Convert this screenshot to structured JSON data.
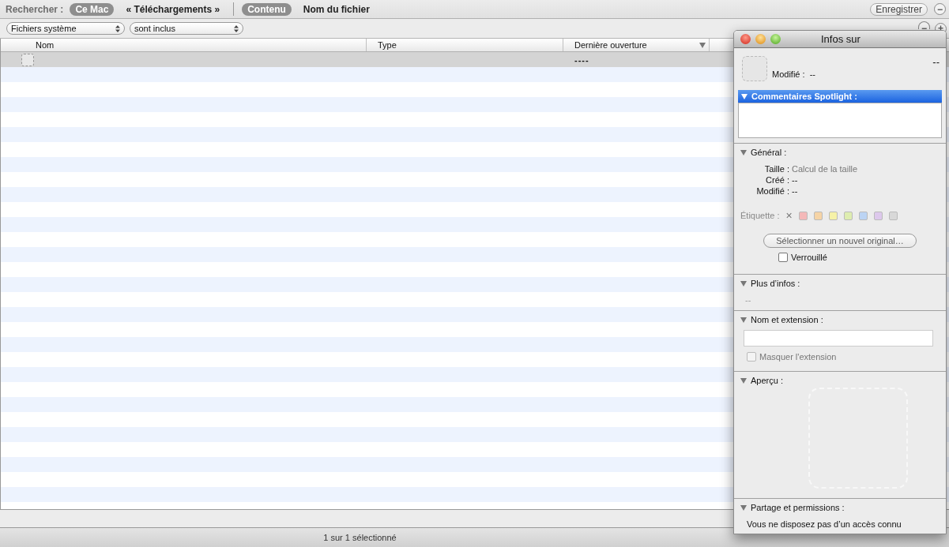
{
  "search_bar": {
    "label": "Rechercher :",
    "scopes": [
      {
        "label": "Ce Mac",
        "selected": true
      },
      {
        "label": "« Téléchargements »",
        "selected": false
      }
    ],
    "criteria": [
      {
        "label": "Contenu",
        "selected": true
      },
      {
        "label": "Nom du fichier",
        "selected": false
      }
    ],
    "save_button": "Enregistrer",
    "remove_symbol": "−"
  },
  "rule": {
    "attribute": "Fichiers système",
    "operator": "sont inclus",
    "remove_symbol": "−",
    "add_symbol": "+"
  },
  "table": {
    "columns": [
      {
        "label": "Nom",
        "sorted": false
      },
      {
        "label": "Type",
        "sorted": false
      },
      {
        "label": "Dernière ouverture",
        "sorted": true
      }
    ],
    "rows": [
      {
        "name": "",
        "type": "",
        "last_opened": "----",
        "selected": true
      }
    ]
  },
  "status_bar": "1 sur 1 sélectionné",
  "info_window": {
    "title": "Infos sur",
    "size_short": "--",
    "modified_label": "Modifié :",
    "modified_value": "--",
    "spotlight": {
      "title": "Commentaires Spotlight :",
      "expanded": true,
      "selected": true
    },
    "general": {
      "title": "Général :",
      "expanded": true,
      "fields": [
        {
          "label": "Taille :",
          "value": "Calcul de la taille",
          "dimmed": true
        },
        {
          "label": "Créé :",
          "value": "--",
          "dimmed": false
        },
        {
          "label": "Modifié :",
          "value": "--",
          "dimmed": false
        }
      ],
      "tag_label": "Étiquette :",
      "tag_clear": "×",
      "tags": [
        {
          "color": "#f4b8b8"
        },
        {
          "color": "#f6d4a6"
        },
        {
          "color": "#f6f2a8"
        },
        {
          "color": "#deedb0"
        },
        {
          "color": "#bcd4f4"
        },
        {
          "color": "#ddc8ec"
        },
        {
          "color": "#d8d8d8"
        }
      ],
      "original_button": "Sélectionner un nouvel original…",
      "locked": {
        "label": "Verrouillé",
        "checked": false,
        "disabled": false
      }
    },
    "more_info": {
      "title": "Plus d’infos :",
      "expanded": true,
      "value": "--"
    },
    "name_ext": {
      "title": "Nom et extension :",
      "expanded": true,
      "hide_ext": {
        "label": "Masquer l'extension",
        "checked": false,
        "disabled": true
      }
    },
    "preview": {
      "title": "Aperçu :",
      "expanded": true
    },
    "sharing": {
      "title": "Partage et permissions :",
      "expanded": true,
      "text": "Vous ne disposez pas d’un accès connu"
    }
  }
}
